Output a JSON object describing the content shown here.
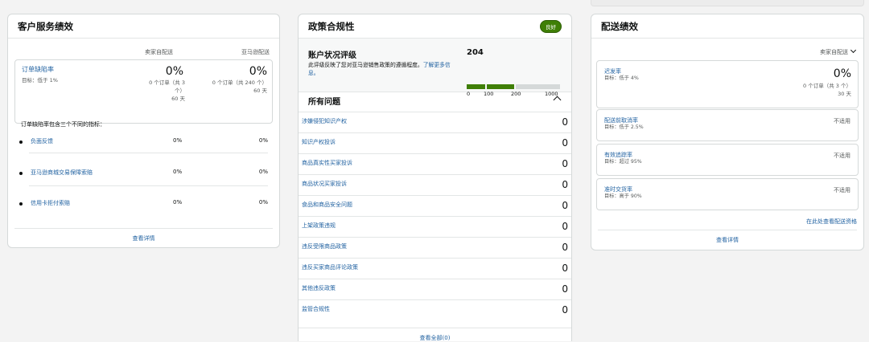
{
  "customer_service": {
    "title": "客户服务绩效",
    "col_seller": "卖家自配送",
    "col_amazon": "亚马逊配送",
    "odr": {
      "title": "订单缺陷率",
      "target": "目标：低于 1%",
      "seller_value": "0%",
      "seller_orders_1": "0 个订单（共 3",
      "seller_orders_2": "个）",
      "seller_days": "60 天",
      "amazon_value": "0%",
      "amazon_orders": "0 个订单（共 240 个）",
      "amazon_days": "60 天"
    },
    "desc": "订单缺陷率包含三个不同的指标：",
    "metrics": [
      {
        "label": "负面反馈",
        "seller": "0%",
        "amazon": "0%"
      },
      {
        "label": "亚马逊商城交易保障索赔",
        "seller": "0%",
        "amazon": "0%"
      },
      {
        "label": "信用卡拒付索赔",
        "seller": "0%",
        "amazon": "0%"
      }
    ],
    "details_link": "查看详情"
  },
  "policy": {
    "title": "政策合规性",
    "badge": "良好",
    "health_title": "账户状况评级",
    "health_desc": "此评级反映了您对亚马逊销售政策的遵循程度。",
    "health_link": "了解更多信息。",
    "score": "204",
    "score_max": 1000,
    "score_value": 204,
    "ticks": [
      "0",
      "100",
      "200",
      "1000"
    ],
    "issues_title": "所有问题",
    "issues": [
      {
        "label": "涉嫌侵犯知识产权",
        "count": "0"
      },
      {
        "label": "知识产权投诉",
        "count": "0"
      },
      {
        "label": "商品真实性买家投诉",
        "count": "0"
      },
      {
        "label": "商品状况买家投诉",
        "count": "0"
      },
      {
        "label": "食品和商品安全问题",
        "count": "0"
      },
      {
        "label": "上架政策违规",
        "count": "0"
      },
      {
        "label": "违反受限商品政策",
        "count": "0"
      },
      {
        "label": "违反买家商品评论政策",
        "count": "0"
      },
      {
        "label": "其他违反政策",
        "count": "0"
      },
      {
        "label": "监管合规性",
        "count": "0"
      }
    ],
    "view_all": "查看全部(0)"
  },
  "shipping": {
    "title": "配送绩效",
    "selector": "卖家自配送",
    "late": {
      "title": "迟发率",
      "target": "目标：低于 4%",
      "value": "0%",
      "orders": "0 个订单（共 3 个）",
      "days": "30 天"
    },
    "boxes": [
      {
        "title": "配送前取消率",
        "target": "目标：低于 2.5%",
        "status": "不适用"
      },
      {
        "title": "有效追踪率",
        "target": "目标：超过 95%",
        "status": "不适用"
      },
      {
        "title": "准时交货率",
        "target": "目标：高于 90%",
        "status": "不适用"
      }
    ],
    "eligibility_link": "在此处查看配送资格",
    "details_link": "查看详情"
  },
  "colors": {
    "accent_link": "#2162a1",
    "good_badge": "#3f7f06",
    "bar_green": "#3f7f06",
    "bar_gray": "#d5d9d9"
  }
}
